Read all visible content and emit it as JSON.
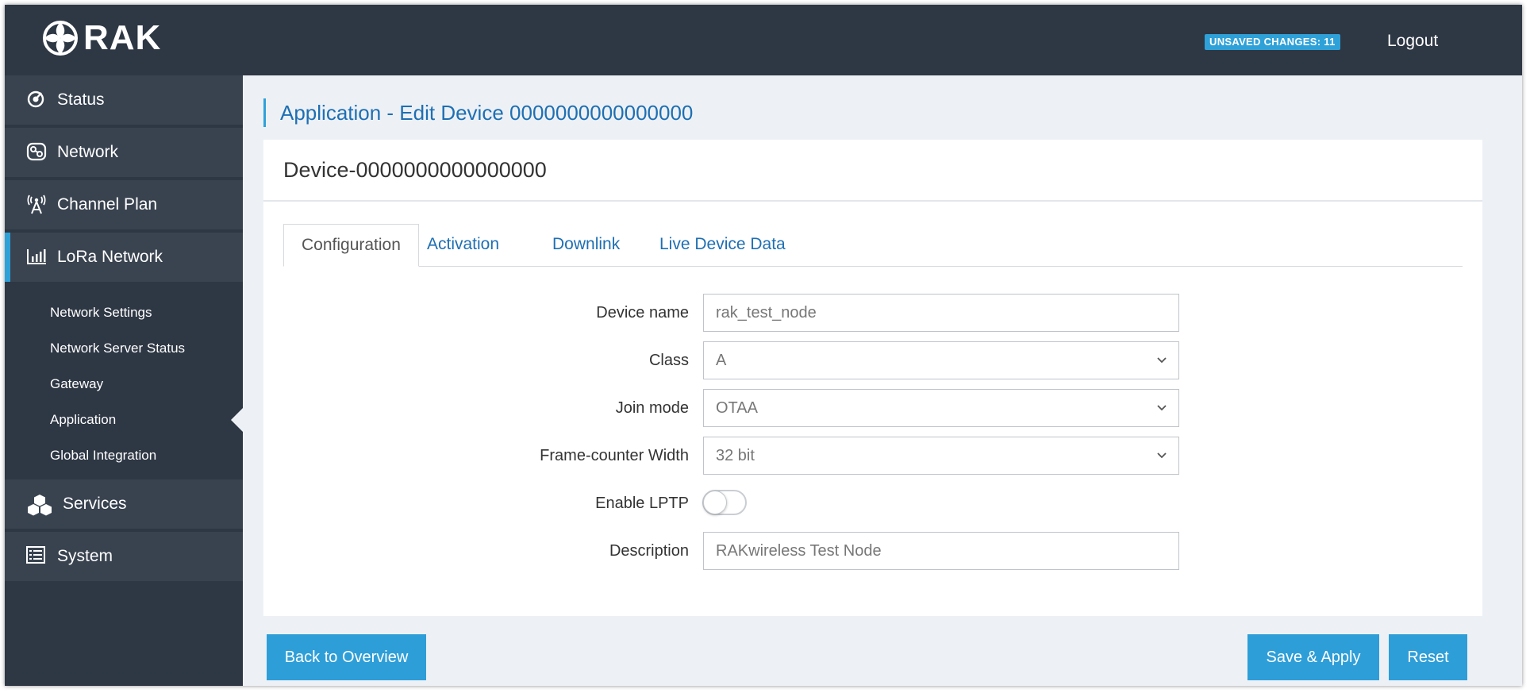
{
  "header": {
    "logo_text": "RAK",
    "unsaved_badge": "UNSAVED CHANGES: 11",
    "logout_label": "Logout"
  },
  "sidebar": {
    "items": [
      {
        "label": "Status",
        "icon": "status-icon"
      },
      {
        "label": "Network",
        "icon": "network-icon"
      },
      {
        "label": "Channel Plan",
        "icon": "antenna-icon"
      },
      {
        "label": "LoRa Network",
        "icon": "signal-bars-icon",
        "active": true
      },
      {
        "label": "Services",
        "icon": "cubes-icon"
      },
      {
        "label": "System",
        "icon": "list-icon"
      }
    ],
    "submenu": [
      {
        "label": "Network Settings"
      },
      {
        "label": "Network Server Status"
      },
      {
        "label": "Gateway"
      },
      {
        "label": "Application",
        "current": true
      },
      {
        "label": "Global Integration"
      }
    ]
  },
  "page": {
    "title": "Application - Edit Device 0000000000000000",
    "card_title": "Device-0000000000000000",
    "tabs": [
      {
        "label": "Configuration",
        "active": true
      },
      {
        "label": "Activation"
      },
      {
        "label": "Downlink"
      },
      {
        "label": "Live Device Data"
      }
    ]
  },
  "form": {
    "device_name": {
      "label": "Device name",
      "value": "rak_test_node"
    },
    "class": {
      "label": "Class",
      "value": "A"
    },
    "join_mode": {
      "label": "Join mode",
      "value": "OTAA"
    },
    "frame_counter": {
      "label": "Frame-counter Width",
      "value": "32 bit"
    },
    "enable_lptp": {
      "label": "Enable LPTP",
      "value": false
    },
    "description": {
      "label": "Description",
      "value": "RAKwireless Test Node"
    }
  },
  "actions": {
    "back_label": "Back to Overview",
    "save_label": "Save & Apply",
    "reset_label": "Reset"
  },
  "colors": {
    "topbar": "#2e3744",
    "accent": "#2fa1d9",
    "link": "#1e6fb3",
    "button": "#2e9ed8",
    "background": "#edf1f5"
  }
}
